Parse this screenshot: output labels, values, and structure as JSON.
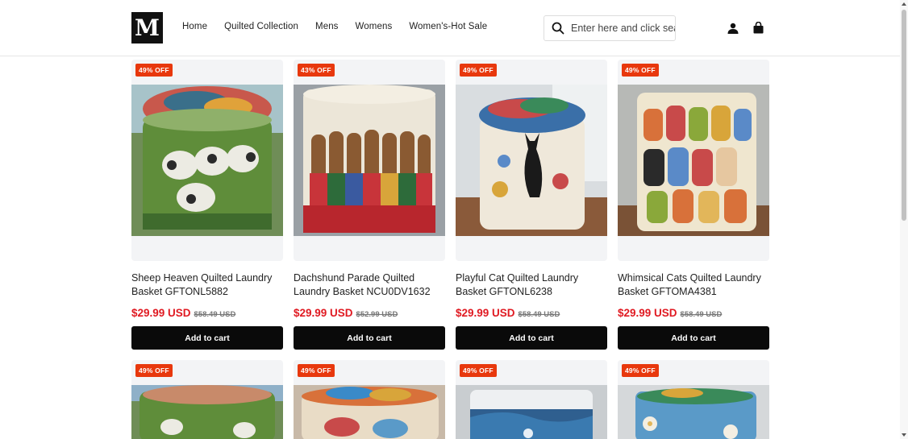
{
  "header": {
    "logo_letter": "M",
    "nav": [
      "Home",
      "Quilted Collection",
      "Mens",
      "Womens",
      "Women's-Hot Sale"
    ],
    "search_placeholder": "Enter here and click search",
    "icons": [
      "account-icon",
      "cart-icon",
      "search-icon"
    ]
  },
  "products": [
    {
      "badge": "49% OFF",
      "title": "Sheep Heaven Quilted Laundry Basket GFTONL5882",
      "price": "$29.99 USD",
      "compare": "$58.49 USD",
      "button": "Add to cart"
    },
    {
      "badge": "43% OFF",
      "title": "Dachshund Parade Quilted Laundry Basket NCU0DV1632",
      "price": "$29.99 USD",
      "compare": "$52.99 USD",
      "button": "Add to cart"
    },
    {
      "badge": "49% OFF",
      "title": "Playful Cat Quilted Laundry Basket GFTONL6238",
      "price": "$29.99 USD",
      "compare": "$58.49 USD",
      "button": "Add to cart"
    },
    {
      "badge": "49% OFF",
      "title": "Whimsical Cats Quilted Laundry Basket GFTOMA4381",
      "price": "$29.99 USD",
      "compare": "$58.49 USD",
      "button": "Add to cart"
    }
  ],
  "products_row2": [
    {
      "badge": "49% OFF"
    },
    {
      "badge": "49% OFF"
    },
    {
      "badge": "49% OFF"
    },
    {
      "badge": "49% OFF"
    }
  ],
  "colors": {
    "badge": "#e8380d",
    "price": "#e01a22",
    "button": "#0a0a0a"
  }
}
